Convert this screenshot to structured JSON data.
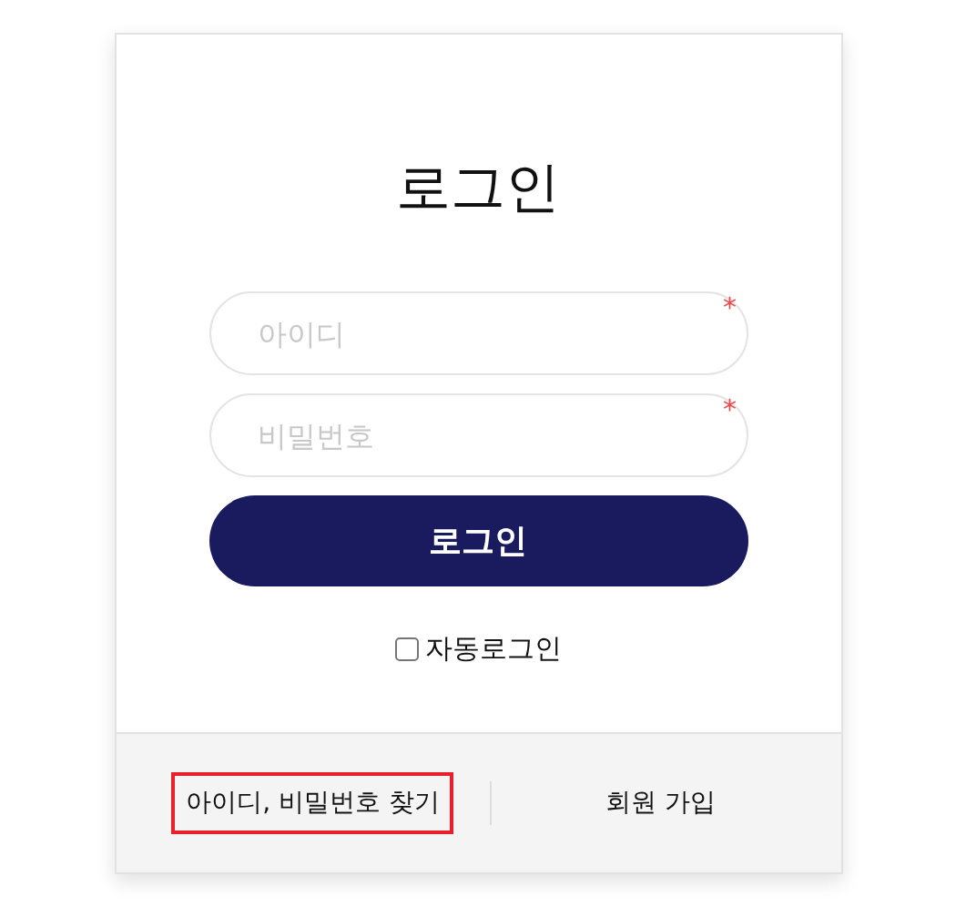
{
  "title": "로그인",
  "fields": [
    {
      "placeholder": "아이디",
      "required_mark": "*"
    },
    {
      "placeholder": "비밀번호",
      "required_mark": "*"
    }
  ],
  "login_button": "로그인",
  "auto_login": {
    "label": "자동로그인",
    "checked": false
  },
  "footer_links": [
    {
      "label": "아이디, 비밀번호 찾기",
      "highlighted": true
    },
    {
      "label": "회원 가입",
      "highlighted": false
    }
  ]
}
